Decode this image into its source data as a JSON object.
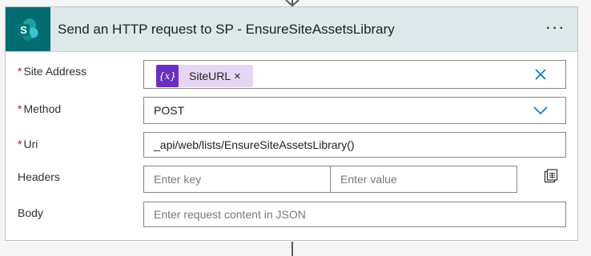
{
  "card": {
    "title": "Send an HTTP request to SP - EnsureSiteAssetsLibrary",
    "icon": "sharepoint-icon",
    "more_label": "···"
  },
  "fields": {
    "site_address": {
      "label": "Site Address",
      "required_mark": "*",
      "token": {
        "icon": "expression-icon",
        "icon_text": "{x}",
        "label": "SiteURL",
        "remove": "×"
      }
    },
    "method": {
      "label": "Method",
      "required_mark": "*",
      "value": "POST"
    },
    "uri": {
      "label": "Uri",
      "required_mark": "*",
      "value": "_api/web/lists/EnsureSiteAssetsLibrary()"
    },
    "headers": {
      "label": "Headers",
      "key_placeholder": "Enter key",
      "value_placeholder": "Enter value"
    },
    "body": {
      "label": "Body",
      "placeholder": "Enter request content in JSON"
    }
  },
  "colors": {
    "header_bg": "#dce8e9",
    "sharepoint_teal": "#036c70",
    "token_purple": "#6b2fbf",
    "token_bg": "#e6d6f4",
    "required_red": "#c50f1f",
    "accent_blue": "#0078d4"
  }
}
